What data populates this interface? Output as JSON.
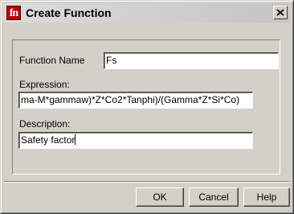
{
  "window": {
    "title": "Create Function",
    "app_icon_text": "fn",
    "close_label": "close"
  },
  "form": {
    "function_name": {
      "label": "Function Name",
      "value": "Fs"
    },
    "expression": {
      "label": "Expression:",
      "value": "ma-M*gammaw)*Z*Co2*Tanphi)/(Gamma*Z*Si*Co)"
    },
    "description": {
      "label": "Description:",
      "value": "Safety factor"
    }
  },
  "buttons": {
    "ok": "OK",
    "cancel": "Cancel",
    "help": "Help"
  },
  "colors": {
    "face": "#d4d0c8",
    "icon_red": "#b80000",
    "field_bg": "#ffffff"
  }
}
